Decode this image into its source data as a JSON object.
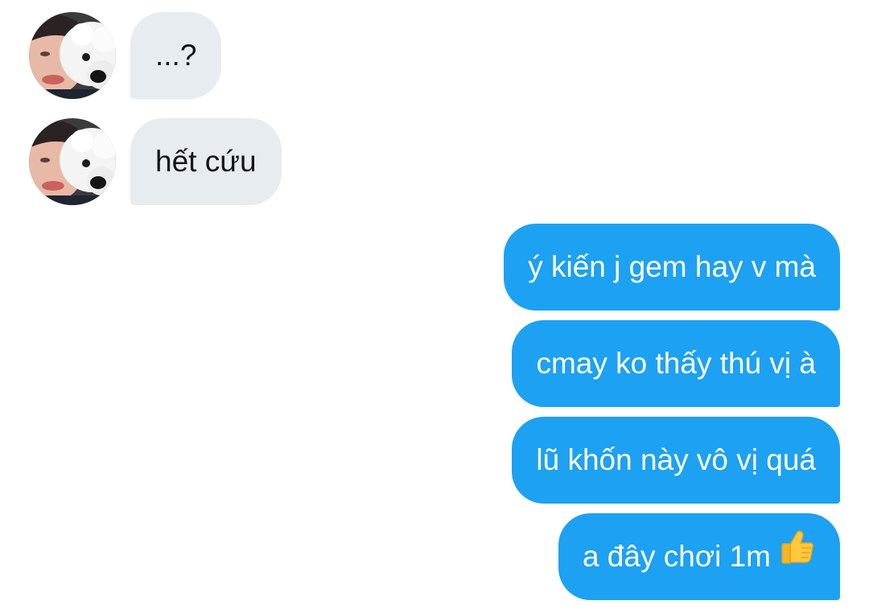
{
  "conversation": {
    "incoming": [
      {
        "text": "...?",
        "avatar": "profile-photo-person-with-white-dog"
      },
      {
        "text": "hết cứu",
        "avatar": "profile-photo-person-with-white-dog"
      }
    ],
    "outgoing": [
      {
        "text": "ý kiến j gem hay v mà"
      },
      {
        "text": "cmay ko thấy thú vị à"
      },
      {
        "text": "lũ khốn này vô vị quá"
      },
      {
        "text": "a đây chơi 1m",
        "emoji": "thumbs-up"
      }
    ]
  },
  "colors": {
    "incoming_bubble": "#e6ecf0",
    "incoming_text": "#14171a",
    "outgoing_bubble": "#1da1f2",
    "outgoing_text": "#ffffff"
  }
}
